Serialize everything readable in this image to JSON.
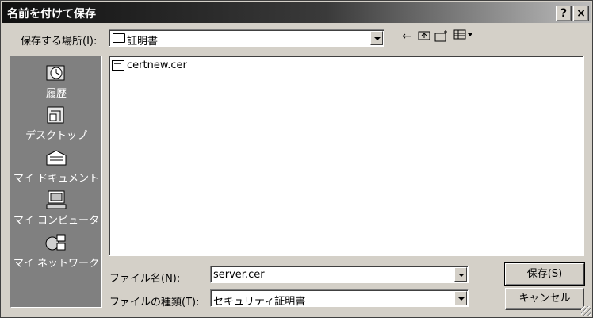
{
  "window": {
    "title": "名前を付けて保存"
  },
  "title_buttons": {
    "help": "?",
    "close": "×"
  },
  "location": {
    "label": "保存する場所(I):",
    "value": "証明書"
  },
  "toolbar": {
    "icons": [
      "back-arrow-icon",
      "up-folder-icon",
      "new-folder-icon",
      "view-menu-icon"
    ]
  },
  "places": [
    {
      "label": "履歴",
      "icon": "history-icon"
    },
    {
      "label": "デスクトップ",
      "icon": "desktop-icon"
    },
    {
      "label": "マイ ドキュメント",
      "icon": "my-documents-icon"
    },
    {
      "label": "マイ コンピュータ",
      "icon": "my-computer-icon"
    },
    {
      "label": "マイ ネットワーク",
      "icon": "my-network-icon"
    }
  ],
  "files": [
    {
      "name": "certnew.cer"
    }
  ],
  "filename": {
    "label": "ファイル名(N):",
    "value": "server.cer"
  },
  "filetype": {
    "label": "ファイルの種類(T):",
    "value": "セキュリティ証明書"
  },
  "buttons": {
    "save": "保存(S)",
    "cancel": "キャンセル"
  }
}
